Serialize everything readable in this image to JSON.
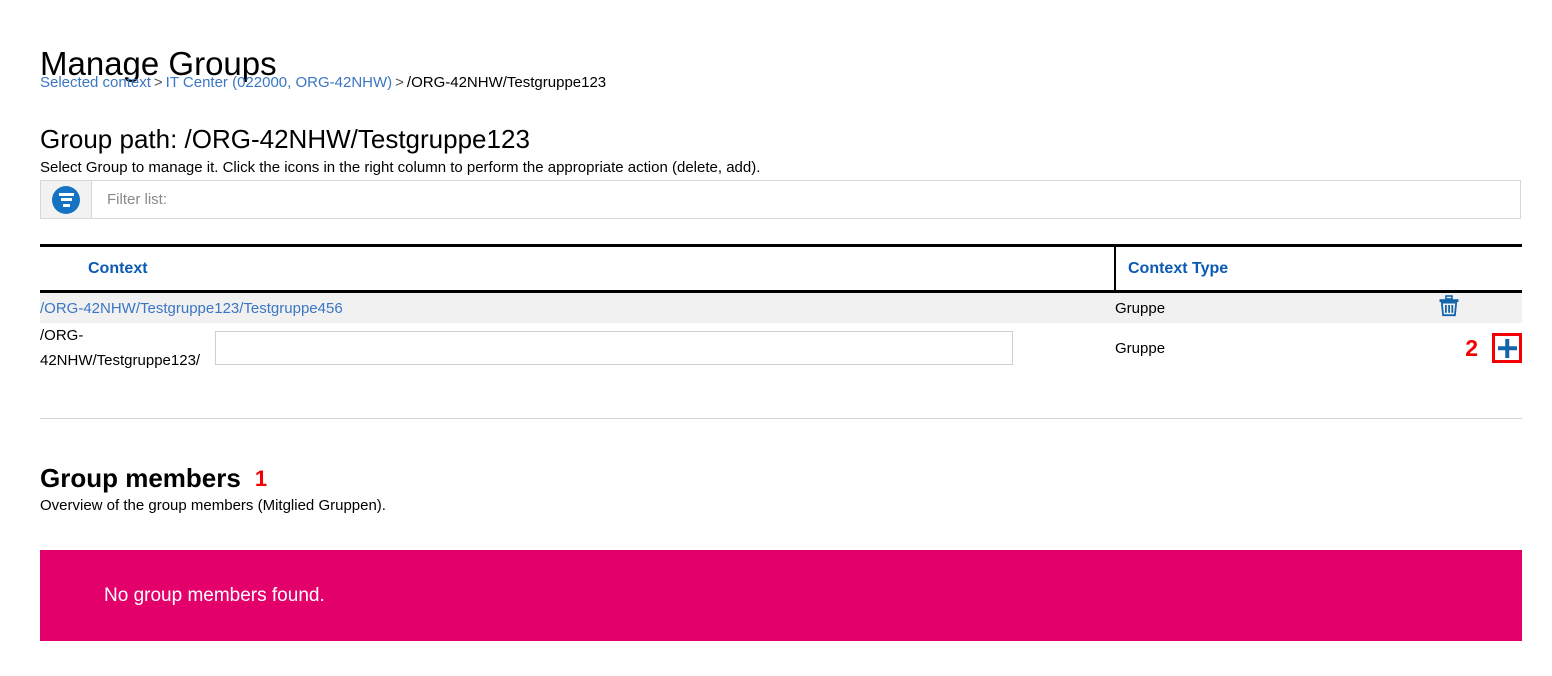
{
  "page": {
    "title": "Manage Groups",
    "group_path_heading": "Group path: /ORG-42NHW/Testgruppe123",
    "intro": "Select Group to manage it. Click the icons in the right column to perform the appropriate action (delete, add)."
  },
  "breadcrumb": {
    "item1": "Selected context",
    "sep1": ">",
    "item2": "IT Center (022000, ORG-42NHW)",
    "sep2": ">",
    "current": "/ORG-42NHW/Testgruppe123"
  },
  "filter": {
    "icon": "filter-icon",
    "placeholder": "Filter list:",
    "value": ""
  },
  "table": {
    "headers": {
      "context": "Context",
      "context_type": "Context Type",
      "action": ""
    },
    "rows": [
      {
        "context": "/ORG-42NHW/Testgruppe123/Testgruppe456",
        "context_type": "Gruppe",
        "action_icon": "trash-icon"
      },
      {
        "context_prefix": "/ORG-42NHW/Testgruppe123/",
        "input_value": "",
        "context_type": "Gruppe",
        "action_icon": "plus-icon",
        "annotation": "2"
      }
    ]
  },
  "members": {
    "heading": "Group members",
    "annotation": "1",
    "subtitle": "Overview of the group members (Mitglied Gruppen)."
  },
  "alert": {
    "message": "No group members found.",
    "background_color": "#e4006b",
    "text_color": "#ffffff"
  },
  "colors": {
    "link": "#3a76c4",
    "header_link": "#0a5ab4",
    "icon_blue": "#1364ab",
    "annotation_red": "#f40000",
    "magenta": "#e4006b"
  }
}
